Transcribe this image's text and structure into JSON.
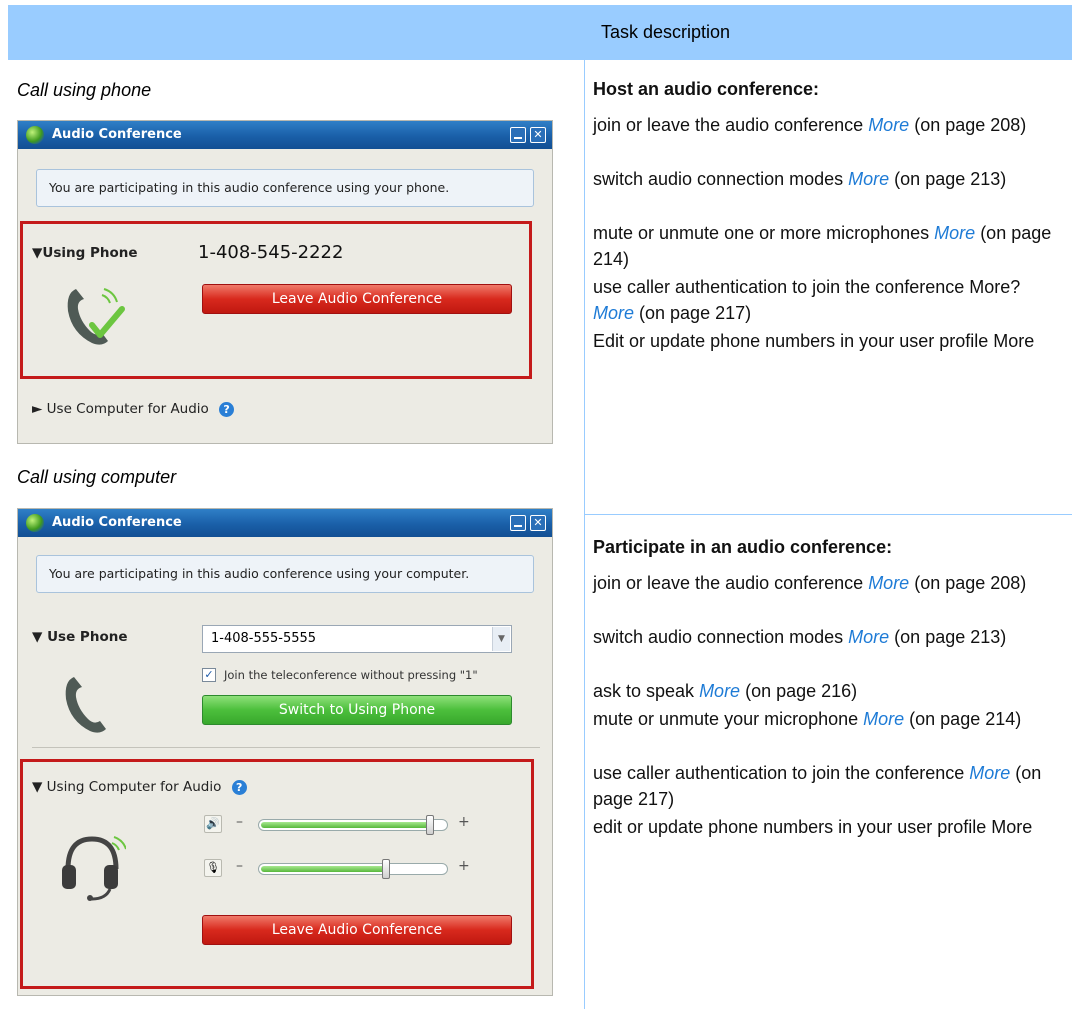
{
  "header": {
    "task_column": "Task description"
  },
  "left": {
    "caption_phone": "Call using phone",
    "caption_computer": "Call using computer",
    "dialog_phone": {
      "title": "Audio Conference",
      "info": "You are participating in this audio conference using your phone.",
      "using_phone_label": "▼Using Phone",
      "phone_number": "1-408-545-2222",
      "leave_button": "Leave Audio Conference",
      "use_computer_label": "► Use Computer for Audio"
    },
    "dialog_computer": {
      "title": "Audio Conference",
      "info": "You are participating in this audio conference using your computer.",
      "use_phone_label": "▼ Use Phone",
      "phone_value": "1-408-555-5555",
      "checkbox_label": "Join the teleconference without pressing \"1\"",
      "switch_button": "Switch to Using Phone",
      "using_computer_label": "▼ Using Computer for Audio",
      "speaker_level": 0.95,
      "mic_level": 0.7,
      "leave_button": "Leave Audio Conference"
    }
  },
  "right": {
    "host": {
      "heading": "Host an audio conference:",
      "items": [
        {
          "pre": "join or leave the audio conference ",
          "link": "More",
          "post": " (on page 208)"
        },
        {
          "pre": "switch audio connection modes ",
          "link": "More",
          "post": " (on page 213)"
        },
        {
          "pre": "mute or unmute one or more microphones ",
          "link": "More",
          "post": " (on page 214)"
        },
        {
          "pre": "use caller authentication to join the conference More? ",
          "link": "More",
          "post": " (on page 217)"
        },
        {
          "pre": "Edit or update phone numbers in your user profile More",
          "link": "",
          "post": ""
        }
      ]
    },
    "participate": {
      "heading": "Participate in an audio conference:",
      "items": [
        {
          "pre": "join or leave the audio conference ",
          "link": "More",
          "post": " (on page 208)"
        },
        {
          "pre": "switch audio connection modes ",
          "link": "More",
          "post": " (on page 213)"
        },
        {
          "pre": "ask to speak ",
          "link": "More",
          "post": " (on page 216)"
        },
        {
          "pre": "mute or unmute your microphone ",
          "link": "More",
          "post": " (on page 214)"
        },
        {
          "pre": "use caller authentication to join the conference ",
          "link": "More",
          "post": " (on page 217)"
        },
        {
          "pre": "edit or update phone numbers in your user profile More",
          "link": "",
          "post": ""
        }
      ]
    }
  },
  "colors": {
    "header_bg": "#99ccff",
    "link": "#1e7bd6",
    "frame_red": "#c41a1a"
  }
}
